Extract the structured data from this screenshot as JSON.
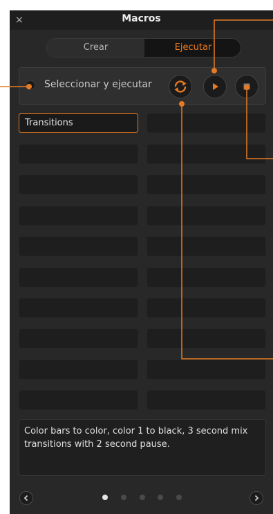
{
  "window": {
    "title": "Macros",
    "close_glyph": "×"
  },
  "tabs": [
    {
      "label": "Crear",
      "selected": false
    },
    {
      "label": "Ejecutar",
      "selected": true
    }
  ],
  "run_bar": {
    "label": "Seleccionar y ejecutar",
    "buttons": [
      {
        "name": "loop",
        "icon": "loop-icon"
      },
      {
        "name": "play",
        "icon": "play-icon"
      },
      {
        "name": "stop",
        "icon": "stop-icon"
      }
    ]
  },
  "macro_slots": [
    "Transitions",
    "",
    "",
    "",
    "",
    "",
    "",
    "",
    "",
    "",
    "",
    "",
    "",
    "",
    "",
    "",
    "",
    "",
    "",
    ""
  ],
  "selected_slot": 0,
  "description": "Color bars to color, color 1 to black, 3 second mix transitions with 2 second pause.",
  "pagination": {
    "pages": 5,
    "current": 1
  },
  "colors": {
    "accent": "#e67a24",
    "panel": "#282828",
    "callout": "#e67a24"
  }
}
